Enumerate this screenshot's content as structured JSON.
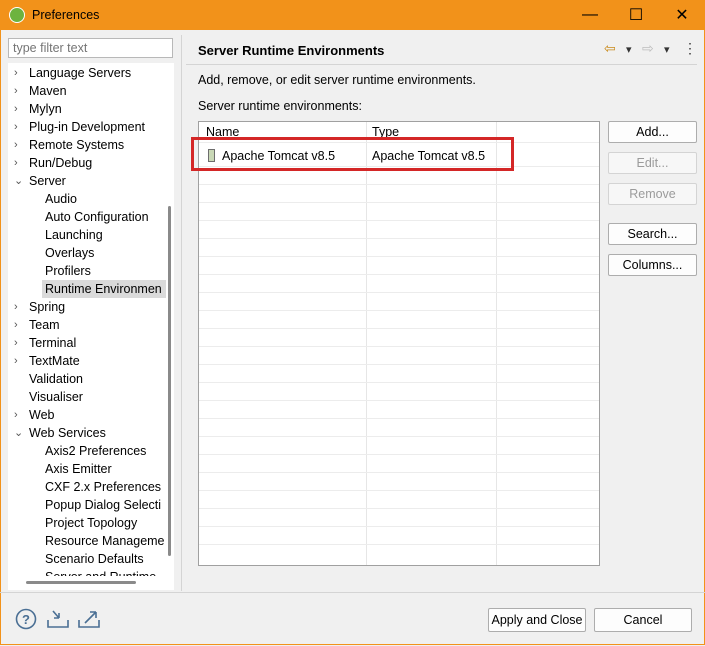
{
  "window": {
    "title": "Preferences",
    "minimize": "—",
    "maximize": "☐",
    "close": "✕"
  },
  "filter": {
    "placeholder": "type filter text"
  },
  "tree": [
    {
      "label": "Language Servers",
      "level": 0,
      "chev": "›"
    },
    {
      "label": "Maven",
      "level": 0,
      "chev": "›"
    },
    {
      "label": "Mylyn",
      "level": 0,
      "chev": "›"
    },
    {
      "label": "Plug-in Development",
      "level": 0,
      "chev": "›"
    },
    {
      "label": "Remote Systems",
      "level": 0,
      "chev": "›"
    },
    {
      "label": "Run/Debug",
      "level": 0,
      "chev": "›"
    },
    {
      "label": "Server",
      "level": 0,
      "chev": "⌄"
    },
    {
      "label": "Audio",
      "level": 1,
      "chev": ""
    },
    {
      "label": "Auto Configuration",
      "level": 1,
      "chev": ""
    },
    {
      "label": "Launching",
      "level": 1,
      "chev": ""
    },
    {
      "label": "Overlays",
      "level": 1,
      "chev": ""
    },
    {
      "label": "Profilers",
      "level": 1,
      "chev": ""
    },
    {
      "label": "Runtime Environmen",
      "level": 1,
      "chev": "",
      "selected": true
    },
    {
      "label": "Spring",
      "level": 0,
      "chev": "›"
    },
    {
      "label": "Team",
      "level": 0,
      "chev": "›"
    },
    {
      "label": "Terminal",
      "level": 0,
      "chev": "›"
    },
    {
      "label": "TextMate",
      "level": 0,
      "chev": "›"
    },
    {
      "label": "Validation",
      "level": 0,
      "chev": ""
    },
    {
      "label": "Visualiser",
      "level": 0,
      "chev": ""
    },
    {
      "label": "Web",
      "level": 0,
      "chev": "›"
    },
    {
      "label": "Web Services",
      "level": 0,
      "chev": "⌄"
    },
    {
      "label": "Axis2 Preferences",
      "level": 1,
      "chev": ""
    },
    {
      "label": "Axis Emitter",
      "level": 1,
      "chev": ""
    },
    {
      "label": "CXF 2.x Preferences",
      "level": 1,
      "chev": ""
    },
    {
      "label": "Popup Dialog Selecti",
      "level": 1,
      "chev": ""
    },
    {
      "label": "Project Topology",
      "level": 1,
      "chev": ""
    },
    {
      "label": "Resource Manageme",
      "level": 1,
      "chev": ""
    },
    {
      "label": "Scenario Defaults",
      "level": 1,
      "chev": ""
    },
    {
      "label": "Server and Runtime",
      "level": 1,
      "chev": ""
    }
  ],
  "page": {
    "title": "Server Runtime Environments",
    "description": "Add, remove, or edit server runtime environments.",
    "list_label": "Server runtime environments:",
    "columns": {
      "name": "Name",
      "type": "Type"
    },
    "rows": [
      {
        "name": "Apache Tomcat v8.5",
        "type": "Apache Tomcat v8.5"
      }
    ],
    "nav": {
      "back": "⇦",
      "back_menu": "▾",
      "forward": "⇨",
      "forward_menu": "▾",
      "more": "⋮"
    }
  },
  "buttons": {
    "add": "Add...",
    "edit": "Edit...",
    "remove": "Remove",
    "search": "Search...",
    "columns": "Columns..."
  },
  "footer": {
    "apply_close": "Apply and Close",
    "cancel": "Cancel"
  },
  "colors": {
    "titlebar": "#f2921a",
    "highlight": "#d42727"
  }
}
